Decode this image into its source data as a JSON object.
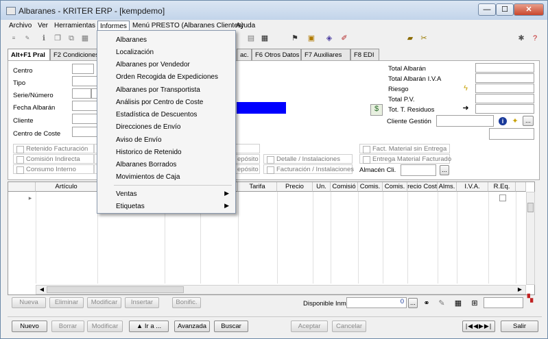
{
  "window": {
    "title": "Albaranes - KRITER ERP -  [kempdemo]",
    "min": "—",
    "max": "☐",
    "close": "✕"
  },
  "menubar": [
    "Archivo",
    "Ver",
    "Herramientas",
    "Informes",
    "Menú PRESTO (Albaranes Clientes)",
    "Ayuda"
  ],
  "dropdown": {
    "items": [
      "Albaranes",
      "Localización",
      "Albaranes por Vendedor",
      "Orden Recogida de Expediciones",
      "Albaranes por Transportista",
      "Análisis por Centro de Coste",
      "Estadística de Descuentos",
      "Direcciones de Envío",
      "Aviso de Envío",
      "Historico de Retenido",
      "Albaranes Borrados",
      "Movimientos de Caja"
    ],
    "submenus": [
      "Ventas",
      "Etiquetas"
    ]
  },
  "tabs": [
    "Alt+F1 Pral",
    "F2 Condiciones",
    "ac.",
    "F6 Otros Datos",
    "F7 Auxiliares",
    "F8 EDI"
  ],
  "form": {
    "left_labels": [
      "Centro",
      "Tipo",
      "Serie/Número",
      "Fecha Albarán",
      "Cliente",
      "Centro de Coste"
    ],
    "right_labels": [
      "Total Albarán",
      "Total Albarán I.V.A",
      "Riesgo",
      "Total P.V.",
      "Tot. T. Residuos"
    ],
    "cliente_gestion": "Cliente Gestión",
    "almacen": "Almacén Cli."
  },
  "checkboxes": {
    "left": [
      "Retenido Facturación",
      "Comisión Indirecta",
      "Consumo Interno"
    ],
    "mid": [
      "epósito",
      "epósito"
    ],
    "mid2": [
      "Detalle / Instalaciones",
      "Facturación / Instalaciones"
    ],
    "right": [
      "Fact. Material sin Entrega",
      "Entrega Material Facturado"
    ]
  },
  "grid": {
    "columns": [
      "Artículo",
      "Tarifa",
      "Precio",
      "Un.",
      "Comisió",
      "Comis.",
      "Comis.",
      "recio Cost",
      "Alms.",
      "I.V.A.",
      "R.Eq."
    ]
  },
  "grid_buttons": [
    "Nueva",
    "Eliminar",
    "Modificar",
    "Insertar",
    "Bonific."
  ],
  "disponible": {
    "label": "Disponible Inmi",
    "value": "0"
  },
  "bottom_buttons": {
    "nuevo": "Nuevo",
    "borrar": "Borrar",
    "modificar": "Modificar",
    "ir": "▲ Ir a ...",
    "avanzada": "Avanzada",
    "buscar": "Buscar",
    "aceptar": "Aceptar",
    "cancelar": "Cancelar",
    "salir": "Salir"
  },
  "colors": {
    "accent_blue": "#0000ff",
    "menu_bg": "#f5f5f5"
  }
}
